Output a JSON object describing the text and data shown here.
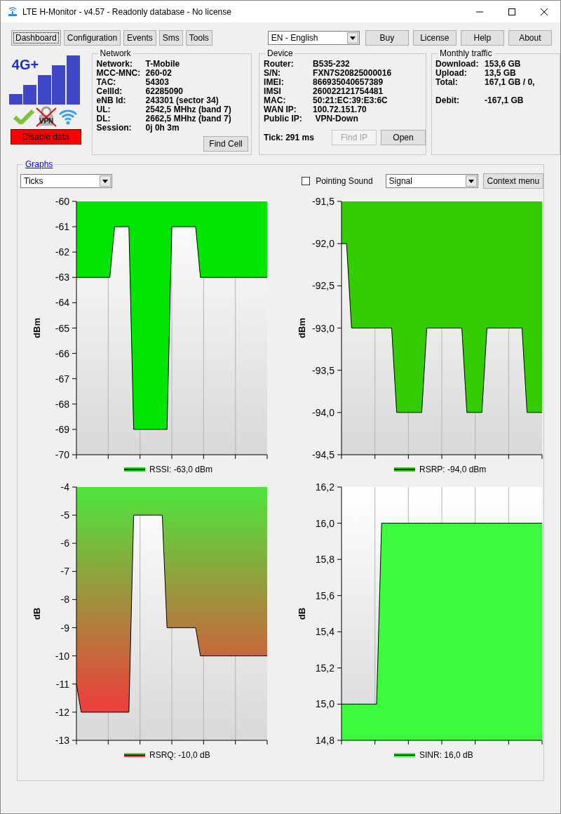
{
  "window": {
    "title": "LTE H-Monitor - v4.57 - Readonly database - No license"
  },
  "tabs": [
    {
      "label": "Dashboard",
      "selected": true
    },
    {
      "label": "Configuration",
      "selected": false
    },
    {
      "label": "Events",
      "selected": false
    },
    {
      "label": "Sms",
      "selected": false
    },
    {
      "label": "Tools",
      "selected": false
    }
  ],
  "language": {
    "value": "EN - English"
  },
  "top_buttons": [
    "Buy",
    "License",
    "Help",
    "About"
  ],
  "status": {
    "network_type": "4G+",
    "vpn_label": "VPN",
    "disable_button": "Disable data"
  },
  "network": {
    "title": "Network",
    "rows": [
      {
        "label": "Network:",
        "value": "T-Mobile"
      },
      {
        "label": "MCC-MNC:",
        "value": "260-02"
      },
      {
        "label": "TAC:",
        "value": "54303"
      },
      {
        "label": "CellId:",
        "value": "62285090"
      },
      {
        "label": "eNB Id:",
        "value": "243301 (sector 34)"
      },
      {
        "label": "UL:",
        "value": "2542,5 MHhz (band 7)"
      },
      {
        "label": "DL:",
        "value": "2662,5 MHhz (band 7)"
      },
      {
        "label": "Session:",
        "value": "0j 0h 3m"
      }
    ],
    "button": "Find Cell"
  },
  "device": {
    "title": "Device",
    "rows": [
      {
        "label": "Router:",
        "value": "B535-232"
      },
      {
        "label": "S/N:",
        "value": "FXN7S20825000016"
      },
      {
        "label": "IMEI:",
        "value": "866935040657389"
      },
      {
        "label": "IMSI",
        "value": "260022121754481"
      },
      {
        "label": "MAC:",
        "value": "50:21:EC:39:E3:6C"
      },
      {
        "label": "WAN IP:",
        "value": "100.72.151.70"
      },
      {
        "label": "Public IP:",
        "value": " VPN-Down"
      }
    ],
    "tick": "Tick: 291 ms",
    "buttons": [
      {
        "label": "Find IP",
        "disabled": true
      },
      {
        "label": "Open",
        "disabled": false
      }
    ]
  },
  "monthly_traffic": {
    "title": "Monthly traffic",
    "rows": [
      {
        "label": "Download:",
        "value": "153,6 GB"
      },
      {
        "label": "Upload:",
        "value": "13,5 GB"
      },
      {
        "label": "Total:",
        "value": "167,1 GB / 0,"
      },
      {
        "label": "Debit:",
        "value": "-167,1 GB"
      }
    ]
  },
  "graphs": {
    "title": "Graphs",
    "mode_select": "Ticks",
    "pointing_sound": {
      "label": "Pointing Sound",
      "checked": false
    },
    "signal_select": "Signal",
    "context_button": "Context menu",
    "charts": [
      {
        "kind": "solid",
        "color": "#00e600",
        "chart_data": {
          "type": "area",
          "ylabel": "dBm",
          "categories": [
            null,
            null,
            null,
            null,
            null,
            null,
            null,
            null,
            null,
            null,
            null,
            null,
            null,
            null,
            null,
            null,
            null,
            null,
            null,
            null,
            null,
            null,
            null,
            null,
            null,
            null,
            null,
            null,
            null,
            null,
            null,
            null,
            null,
            null,
            null,
            null,
            null,
            null,
            null,
            null,
            null
          ],
          "ylim": [
            -70,
            -60
          ],
          "yticks": [
            {
              "value": -60,
              "label": "-60"
            },
            {
              "value": -61,
              "label": "-61"
            },
            {
              "value": -62,
              "label": "-62"
            },
            {
              "value": -63,
              "label": "-63"
            },
            {
              "value": -64,
              "label": "-64"
            },
            {
              "value": -65,
              "label": "-65"
            },
            {
              "value": -66,
              "label": "-66"
            },
            {
              "value": -67,
              "label": "-67"
            },
            {
              "value": -68,
              "label": "-68"
            },
            {
              "value": -69,
              "label": "-69"
            },
            {
              "value": -70,
              "label": "-70"
            }
          ],
          "series": [
            {
              "name": "RSSI: -63,0 dBm",
              "color": "#000000",
              "values": [
                -63,
                -63,
                -63,
                -63,
                -63,
                -63,
                -63,
                -63,
                -61,
                -61,
                -61,
                -61,
                -69,
                -69,
                -69,
                -69,
                -69,
                -69,
                -69,
                -69,
                -61,
                -61,
                -61,
                -61,
                -61,
                -61,
                -63,
                -63,
                -63,
                -63,
                -63,
                -63,
                -63,
                -63,
                -63,
                -63,
                -63,
                -63,
                -63,
                -63,
                -63
              ]
            }
          ]
        }
      },
      {
        "kind": "solid",
        "color": "#33cc00",
        "chart_data": {
          "type": "area",
          "ylabel": "dBm",
          "categories": [
            null,
            null,
            null,
            null,
            null,
            null,
            null,
            null,
            null,
            null,
            null,
            null,
            null,
            null,
            null,
            null,
            null,
            null,
            null,
            null,
            null,
            null,
            null,
            null,
            null,
            null,
            null,
            null,
            null,
            null,
            null,
            null,
            null,
            null,
            null,
            null,
            null,
            null,
            null,
            null,
            null
          ],
          "ylim": [
            -94.5,
            -91.5
          ],
          "yticks": [
            {
              "value": -91.5,
              "label": "-91,5"
            },
            {
              "value": -92,
              "label": "-92,0"
            },
            {
              "value": -92.5,
              "label": "-92,5"
            },
            {
              "value": -93,
              "label": "-93,0"
            },
            {
              "value": -93.5,
              "label": "-93,5"
            },
            {
              "value": -94,
              "label": "-94,0"
            },
            {
              "value": -94.5,
              "label": "-94,5"
            }
          ],
          "series": [
            {
              "name": "RSRP: -94,0 dBm",
              "color": "#000000",
              "values": [
                -92,
                -92,
                -93,
                -93,
                -93,
                -93,
                -93,
                -93,
                -93,
                -93,
                -93,
                -94,
                -94,
                -94,
                -94,
                -94,
                -94,
                -93,
                -93,
                -93,
                -93,
                -93,
                -93,
                -93,
                -93,
                -94,
                -94,
                -94,
                -94,
                -93,
                -93,
                -93,
                -93,
                -93,
                -93,
                -93,
                -93,
                -94,
                -94,
                -94,
                -94
              ]
            }
          ]
        }
      },
      {
        "kind": "gradient",
        "color": "#4ee63c",
        "chart_data": {
          "type": "area",
          "ylabel": "dB",
          "categories": [
            null,
            null,
            null,
            null,
            null,
            null,
            null,
            null,
            null,
            null,
            null,
            null,
            null,
            null,
            null,
            null,
            null,
            null,
            null,
            null,
            null,
            null,
            null,
            null,
            null,
            null,
            null,
            null,
            null,
            null,
            null,
            null,
            null,
            null,
            null,
            null,
            null,
            null,
            null,
            null,
            null
          ],
          "ylim": [
            -13,
            -4
          ],
          "yticks": [
            {
              "value": -4,
              "label": "-4"
            },
            {
              "value": -5,
              "label": "-5"
            },
            {
              "value": -6,
              "label": "-6"
            },
            {
              "value": -7,
              "label": "-7"
            },
            {
              "value": -8,
              "label": "-8"
            },
            {
              "value": -9,
              "label": "-9"
            },
            {
              "value": -10,
              "label": "-10"
            },
            {
              "value": -11,
              "label": "-11"
            },
            {
              "value": -12,
              "label": "-12"
            },
            {
              "value": -13,
              "label": "-13"
            }
          ],
          "series": [
            {
              "name": "RSRQ: -10,0 dB",
              "color": "#000000",
              "values": [
                -11,
                -12,
                -12,
                -12,
                -12,
                -12,
                -12,
                -12,
                -12,
                -12,
                -12,
                -12,
                -5,
                -5,
                -5,
                -5,
                -5,
                -5,
                -5,
                -9,
                -9,
                -9,
                -9,
                -9,
                -9,
                -9,
                -10,
                -10,
                -10,
                -10,
                -10,
                -10,
                -10,
                -10,
                -10,
                -10,
                -10,
                -10,
                -10,
                -10,
                -10
              ]
            }
          ]
        }
      },
      {
        "kind": "solid",
        "color": "#3cfa3c",
        "chart_data": {
          "type": "area",
          "ylabel": "dB",
          "categories": [
            null,
            null,
            null,
            null,
            null,
            null,
            null,
            null,
            null,
            null,
            null,
            null,
            null,
            null,
            null,
            null,
            null,
            null,
            null,
            null,
            null,
            null,
            null,
            null,
            null,
            null,
            null,
            null,
            null,
            null,
            null,
            null,
            null,
            null,
            null,
            null,
            null,
            null,
            null,
            null,
            null
          ],
          "ylim": [
            14.8,
            16.2
          ],
          "yticks": [
            {
              "value": 16.2,
              "label": "16,2"
            },
            {
              "value": 16,
              "label": "16,0"
            },
            {
              "value": 15.8,
              "label": "15,8"
            },
            {
              "value": 15.6,
              "label": "15,6"
            },
            {
              "value": 15.4,
              "label": "15,4"
            },
            {
              "value": 15.2,
              "label": "15,2"
            },
            {
              "value": 15,
              "label": "15,0"
            },
            {
              "value": 14.8,
              "label": "14,8"
            }
          ],
          "series": [
            {
              "name": "SINR: 16,0 dB",
              "color": "#000000",
              "values": [
                15,
                15,
                15,
                15,
                15,
                15,
                15,
                15,
                16,
                16,
                16,
                16,
                16,
                16,
                16,
                16,
                16,
                16,
                16,
                16,
                16,
                16,
                16,
                16,
                16,
                16,
                16,
                16,
                16,
                16,
                16,
                16,
                16,
                16,
                16,
                16,
                16,
                16,
                16,
                16,
                16
              ]
            }
          ]
        }
      }
    ]
  }
}
